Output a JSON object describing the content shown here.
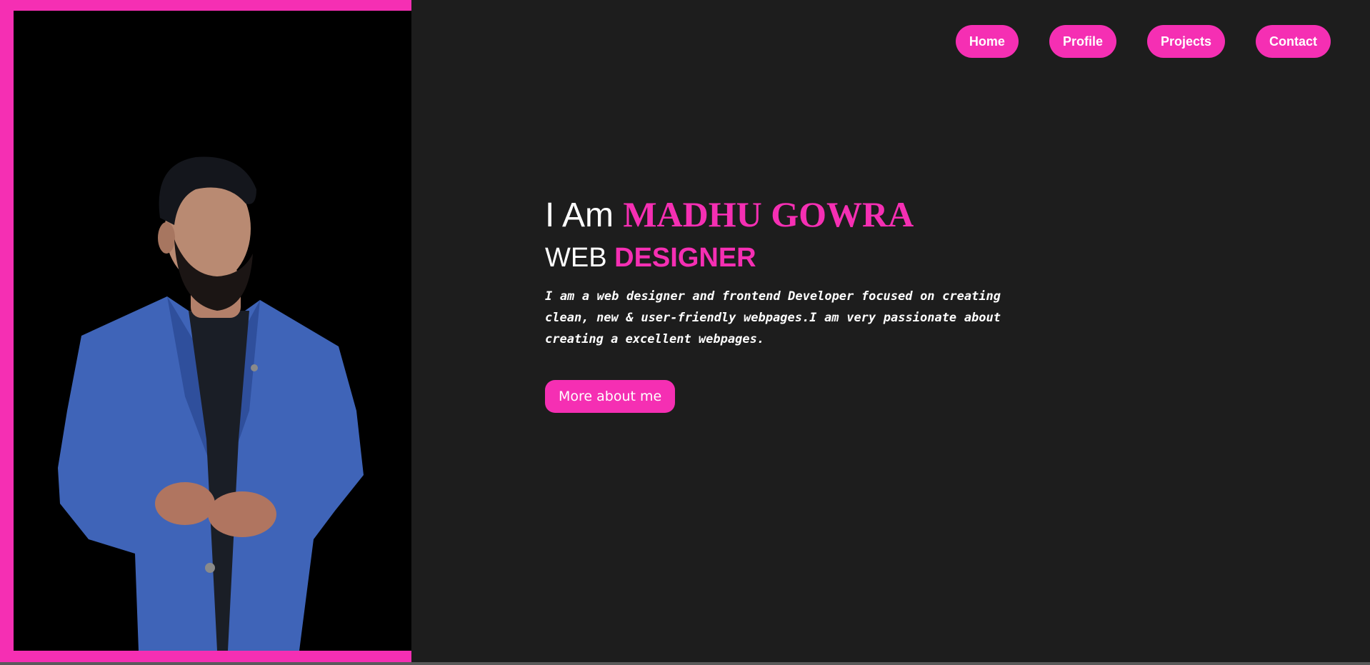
{
  "nav": {
    "items": [
      {
        "label": "Home"
      },
      {
        "label": "Profile"
      },
      {
        "label": "Projects"
      },
      {
        "label": "Contact"
      }
    ]
  },
  "hero": {
    "greeting_prefix": "I Am ",
    "name": "MADHU GOWRA",
    "role_prefix": "WEB ",
    "role_accent": "DESIGNER",
    "bio": "I am a web designer and frontend Developer focused on creating clean, new & user-friendly webpages.I am very passionate about creating a excellent webpages.",
    "cta_label": "More about me"
  },
  "colors": {
    "accent": "#f52fb3",
    "background": "#1d1d1d",
    "photo_background": "#000000",
    "text": "#ffffff"
  }
}
